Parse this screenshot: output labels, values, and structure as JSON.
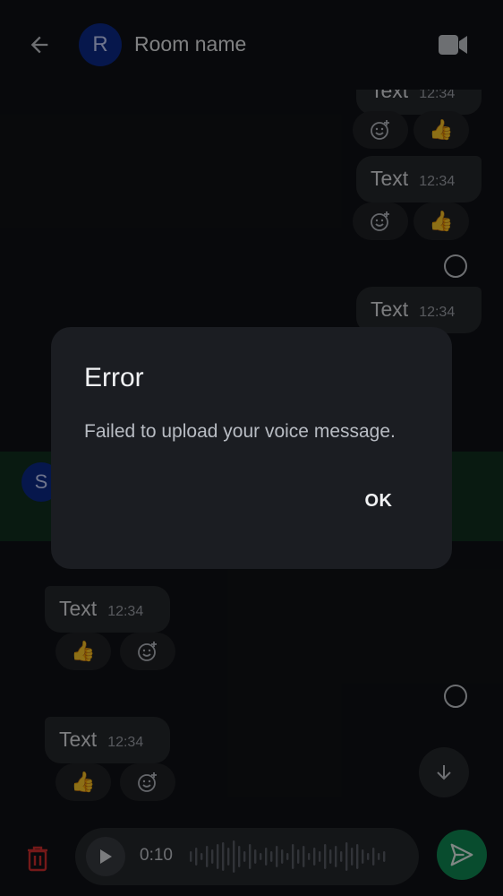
{
  "header": {
    "avatar_initial": "R",
    "room_name": "Room name"
  },
  "timeline": {
    "messages": [
      {
        "text": "Text",
        "time": "12:34",
        "reaction": "👍"
      },
      {
        "text": "Text",
        "time": "12:34",
        "reaction": "👍"
      },
      {
        "text": "Text",
        "time": "12:34"
      },
      {
        "text": "Text",
        "time": "12:34",
        "reaction": "👍"
      },
      {
        "text": "Text",
        "time": "12:34",
        "reaction": "👍"
      }
    ],
    "sender_initial": "S"
  },
  "composer": {
    "duration": "0:10"
  },
  "dialog": {
    "title": "Error",
    "message": "Failed to upload your voice message.",
    "ok_label": "OK"
  },
  "colors": {
    "accent": "#0f8a54",
    "avatar": "#0c2a8a",
    "danger": "#d32f2f"
  },
  "icons": [
    "back-arrow-icon",
    "video-call-icon",
    "add-reaction-icon",
    "read-receipt-icon",
    "scroll-down-icon",
    "trash-icon",
    "play-icon",
    "send-icon"
  ]
}
